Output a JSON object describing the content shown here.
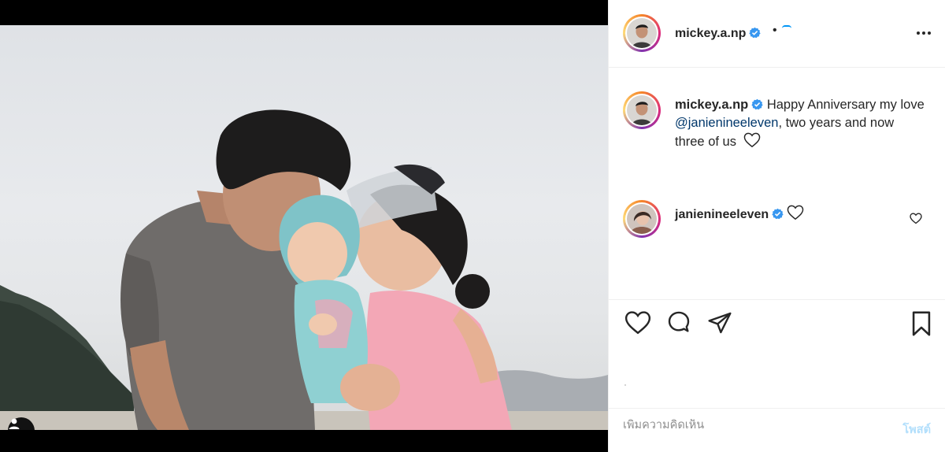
{
  "post": {
    "author": "mickey.a.np",
    "header_separator": "•",
    "caption": {
      "author": "mickey.a.np",
      "text_before": "Happy Anniversary my love ",
      "mention": "@janienineeleven",
      "text_after": ", two years and now three of us"
    },
    "comments": [
      {
        "author": "janienineeleven"
      }
    ],
    "comment_placeholder": "เพิ่มความคิดเห็น",
    "post_label": "โพสต์"
  },
  "icons": {
    "verified": "verified-badge-icon",
    "more": "more-options-icon",
    "like": "heart-icon",
    "comment": "comment-icon",
    "share": "paper-plane-icon",
    "save": "bookmark-icon",
    "tag": "user-tag-icon"
  },
  "colors": {
    "verified_blue": "#3897f0",
    "mention": "#00376b",
    "post_button_disabled": "#b2dffc",
    "placeholder": "#8e8e8e"
  }
}
